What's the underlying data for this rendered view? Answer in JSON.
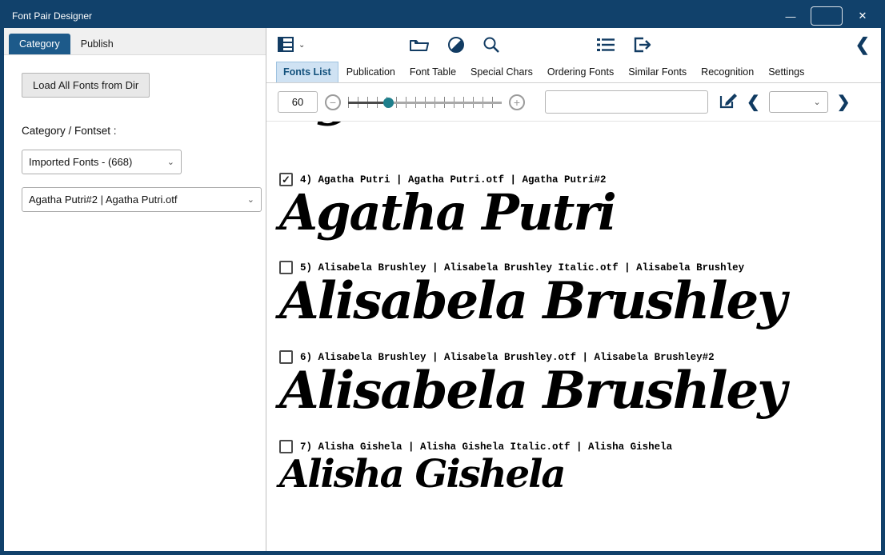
{
  "window": {
    "title": "Font Pair Designer",
    "minimize_glyph": "—",
    "maximize_glyph": "",
    "close_glyph": "✕"
  },
  "colors": {
    "titlebar": "#11416b",
    "active_tab": "#1d5a8a",
    "fonts_list_tab_bg": "#cfe2f3",
    "slider_thumb": "#1f7f8c",
    "icon_navy": "#123c63"
  },
  "sidebar": {
    "tabs": [
      {
        "label": "Category"
      },
      {
        "label": "Publish"
      }
    ],
    "load_button": "Load All Fonts from Dir",
    "fontset_label": "Category / Fontset :",
    "category_select": "Imported Fonts - (668)",
    "font_select": "Agatha Putri#2 | Agatha Putri.otf"
  },
  "main": {
    "tabs": [
      {
        "label": "Fonts List"
      },
      {
        "label": "Publication"
      },
      {
        "label": "Font Table"
      },
      {
        "label": "Special Chars"
      },
      {
        "label": "Ordering Fonts"
      },
      {
        "label": "Similar Fonts"
      },
      {
        "label": "Recognition"
      },
      {
        "label": "Settings"
      }
    ],
    "font_size_value": "60",
    "search_value": "",
    "search_placeholder": "",
    "page_select_value": "",
    "clipped_preview": "Agatha Putri",
    "fonts": [
      {
        "label": "4) Agatha Putri | Agatha Putri.otf | Agatha Putri#2",
        "preview": "Agatha Putri",
        "check": "✓"
      },
      {
        "label": "5) Alisabela Brushley | Alisabela Brushley Italic.otf | Alisabela Brushley",
        "preview": "Alisabela Brushley",
        "check": ""
      },
      {
        "label": "6) Alisabela Brushley | Alisabela Brushley.otf | Alisabela Brushley#2",
        "preview": "Alisabela Brushley",
        "check": ""
      },
      {
        "label": "7) Alisha Gishela | Alisha Gishela Italic.otf | Alisha Gishela",
        "preview": "Alisha Gishela",
        "check": ""
      }
    ]
  }
}
